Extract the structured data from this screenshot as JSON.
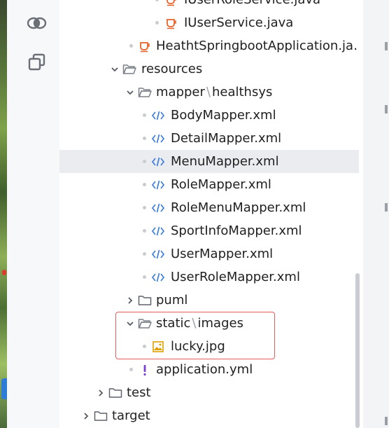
{
  "colors": {
    "panel_bg": "#ffffff",
    "selected_row": "#ebecf0",
    "folder_icon": "#7c8089",
    "xml_icon": "#3d7eda",
    "java_icon": "#e8632b",
    "image_icon": "#e0a100",
    "yml_icon": "#7a3fd1",
    "highlight_border": "#e55a5a"
  },
  "stripe": {
    "icons": [
      "cloud-sync-icon",
      "copy-window-icon"
    ]
  },
  "tree": {
    "rows": [
      {
        "label": "IUserRoleService.java",
        "icon": "java-class-icon"
      },
      {
        "label": "IUserService.java",
        "icon": "java-class-icon"
      },
      {
        "label": "HeathtSpringbootApplication.ja…",
        "icon": "java-class-icon"
      },
      {
        "label": "resources",
        "icon": "folder-open-icon"
      },
      {
        "label": "mapper",
        "label2": "healthsys",
        "icon": "folder-open-icon"
      },
      {
        "label": "BodyMapper.xml",
        "icon": "xml-file-icon"
      },
      {
        "label": "DetailMapper.xml",
        "icon": "xml-file-icon"
      },
      {
        "label": "MenuMapper.xml",
        "icon": "xml-file-icon",
        "selected": true
      },
      {
        "label": "RoleMapper.xml",
        "icon": "xml-file-icon"
      },
      {
        "label": "RoleMenuMapper.xml",
        "icon": "xml-file-icon"
      },
      {
        "label": "SportInfoMapper.xml",
        "icon": "xml-file-icon"
      },
      {
        "label": "UserMapper.xml",
        "icon": "xml-file-icon"
      },
      {
        "label": "UserRoleMapper.xml",
        "icon": "xml-file-icon"
      },
      {
        "label": "puml",
        "icon": "folder-icon"
      },
      {
        "label": "static",
        "label2": "images",
        "icon": "folder-open-icon"
      },
      {
        "label": "lucky.jpg",
        "icon": "image-file-icon"
      },
      {
        "label": "application.yml",
        "icon": "yml-file-icon"
      },
      {
        "label": "test",
        "icon": "folder-icon"
      },
      {
        "label": "target",
        "icon": "folder-icon"
      }
    ],
    "path_separator": "\\"
  }
}
